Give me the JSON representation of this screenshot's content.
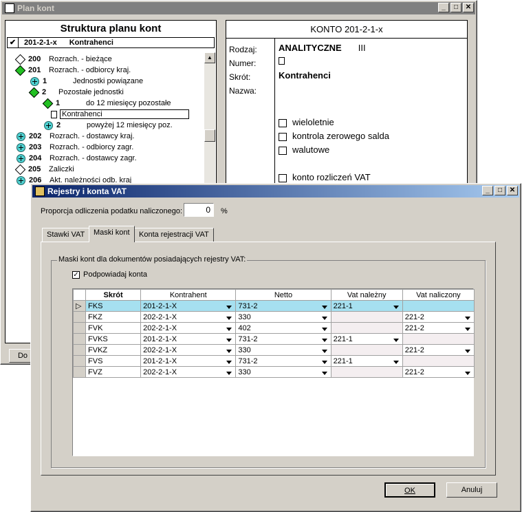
{
  "back_window": {
    "title": "Plan kont",
    "tree_title": "Struktura planu kont",
    "selected_code": "201-2-1-x",
    "selected_name": "Kontrahenci",
    "rows": [
      {
        "code": "200",
        "name": "Rozrach. - bieżące",
        "icon": "white"
      },
      {
        "code": "201",
        "name": "Rozrach. - odbiorcy kraj.",
        "icon": "green"
      },
      {
        "code": "1",
        "name": "Jednostki powiązane",
        "icon": "plus"
      },
      {
        "code": "2",
        "name": "Pozostałe jednostki",
        "icon": "green"
      },
      {
        "code": "1",
        "name": "do 12 miesięcy pozostałe",
        "icon": "green"
      },
      {
        "code": "",
        "name": "Kontrahenci",
        "icon": "doc"
      },
      {
        "code": "2",
        "name": "powyżej 12 miesięcy poz.",
        "icon": "plus"
      },
      {
        "code": "202",
        "name": "Rozrach. - dostawcy kraj.",
        "icon": "plus"
      },
      {
        "code": "203",
        "name": "Rozrach. - odbiorcy zagr.",
        "icon": "plus"
      },
      {
        "code": "204",
        "name": "Rozrach. - dostawcy zagr.",
        "icon": "plus"
      },
      {
        "code": "205",
        "name": "Zaliczki",
        "icon": "white"
      },
      {
        "code": "206",
        "name": "Akt. należności odb. kraj",
        "icon": "plus"
      }
    ],
    "bottom_button": "Do",
    "konto": {
      "header": "KONTO  201-2-1-x",
      "rodzaj_label": "Rodzaj:",
      "rodzaj_value": "ANALITYCZNE",
      "rodzaj_level": "III",
      "numer_label": "Numer:",
      "skrot_label": "Skrót:",
      "skrot_value": "Kontrahenci",
      "nazwa_label": "Nazwa:",
      "checkboxes": [
        "wieloletnie",
        "kontrola zerowego salda",
        "walutowe"
      ],
      "vat_checkbox": "konto rozliczeń VAT"
    }
  },
  "dialog": {
    "title": "Rejestry i konta VAT",
    "proportion_label": "Proporcja odliczenia podatku naliczonego:",
    "proportion_value": "0",
    "percent": "%",
    "tabs": [
      "Stawki VAT",
      "Maski kont",
      "Konta rejestracji VAT"
    ],
    "active_tab": "Maski kont",
    "group_label": "Maski kont dla dokumentów posiadających rejestry VAT:",
    "suggest_label": "Podpowiadaj konta",
    "suggest_checked": true,
    "columns": [
      "Skrót",
      "Kontrahent",
      "Netto",
      "Vat należny",
      "Vat naliczony"
    ],
    "rows": [
      {
        "skrot": "FKS",
        "kontrahent": "201-2-1-X",
        "netto": "731-2",
        "vat_nalezny": "221-1",
        "vat_naliczony": ""
      },
      {
        "skrot": "FKZ",
        "kontrahent": "202-2-1-X",
        "netto": "330",
        "vat_nalezny": "",
        "vat_naliczony": "221-2"
      },
      {
        "skrot": "FVK",
        "kontrahent": "202-2-1-X",
        "netto": "402",
        "vat_nalezny": "",
        "vat_naliczony": "221-2"
      },
      {
        "skrot": "FVKS",
        "kontrahent": "201-2-1-X",
        "netto": "731-2",
        "vat_nalezny": "221-1",
        "vat_naliczony": ""
      },
      {
        "skrot": "FVKZ",
        "kontrahent": "202-2-1-X",
        "netto": "330",
        "vat_nalezny": "",
        "vat_naliczony": "221-2"
      },
      {
        "skrot": "FVS",
        "kontrahent": "201-2-1-X",
        "netto": "731-2",
        "vat_nalezny": "221-1",
        "vat_naliczony": ""
      },
      {
        "skrot": "FVZ",
        "kontrahent": "202-2-1-X",
        "netto": "330",
        "vat_nalezny": "",
        "vat_naliczony": "221-2"
      }
    ],
    "ok_label": "OK",
    "cancel_label": "Anuluj"
  }
}
